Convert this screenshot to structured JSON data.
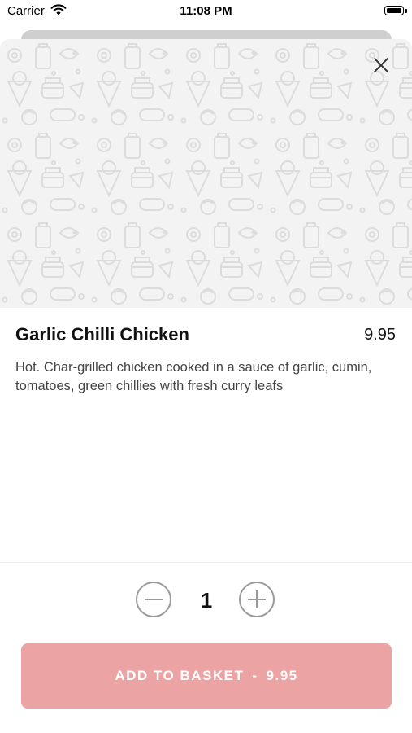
{
  "status_bar": {
    "carrier": "Carrier",
    "time": "11:08 PM",
    "icons": [
      "wifi-icon",
      "battery-icon"
    ]
  },
  "item": {
    "title": "Garlic Chilli Chicken",
    "price": "9.95",
    "description": "Hot. Char-grilled chicken cooked in a sauce of garlic, cumin, tomatoes, green chillies with fresh curry leafs"
  },
  "hero": {
    "image": "food-doodle-pattern",
    "close_icon": "close-icon"
  },
  "quantity": {
    "value": "1",
    "minus_icon": "minus-circle-icon",
    "plus_icon": "plus-circle-icon"
  },
  "basket_button": {
    "label": "ADD TO BASKET",
    "separator": "-",
    "price": "9.95"
  },
  "colors": {
    "accent": "#eba3a3",
    "hero_background": "#f3f3f3",
    "text_primary": "#111111",
    "text_secondary": "#444444"
  }
}
